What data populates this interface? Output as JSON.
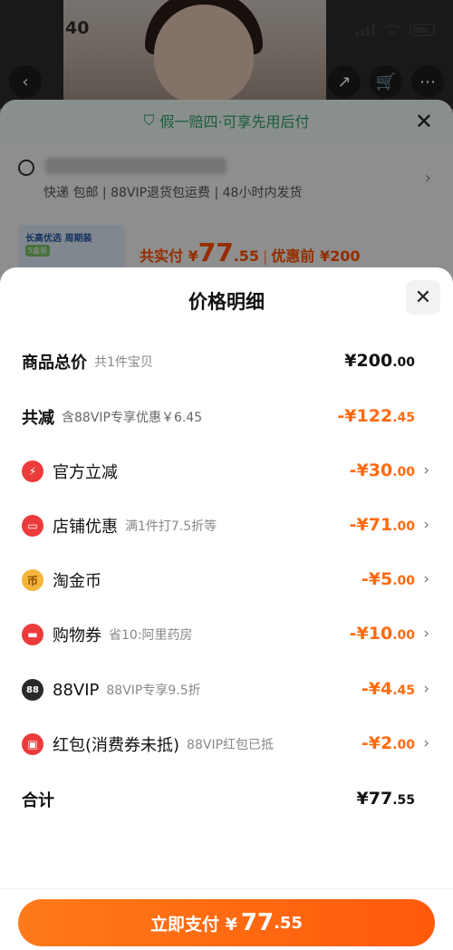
{
  "status": {
    "time": "11:40"
  },
  "background": {
    "banner": "假一赔四·可享先用后付",
    "address_sub": "快递 包邮 | 88VIP退货包运费 | 48小时内发货",
    "thumb_tag": "长高优选 周期装",
    "thumb_badge": "5盒装",
    "summary_label": "共实付 ¥",
    "summary_amount": "77",
    "summary_cents": ".55",
    "summary_before": "优惠前 ¥200"
  },
  "modal": {
    "title": "价格明细",
    "rows": [
      {
        "label": "商品总价",
        "note": "共1件宝贝",
        "amount": "¥200",
        "cents": ".00",
        "icon": "",
        "chevron": false
      },
      {
        "label": "共减",
        "note": "含88VIP专享优惠￥6.45",
        "amount": "-¥122",
        "cents": ".45",
        "icon": "",
        "chevron": false
      },
      {
        "label": "官方立减",
        "note": "",
        "amount": "-¥30",
        "cents": ".00",
        "icon": "lightning-icon",
        "chevron": true
      },
      {
        "label": "店铺优惠",
        "note": "满1件打7.5折等",
        "amount": "-¥71",
        "cents": ".00",
        "icon": "shop-icon",
        "chevron": true
      },
      {
        "label": "淘金币",
        "note": "",
        "amount": "-¥5",
        "cents": ".00",
        "icon": "coin-icon",
        "chevron": true
      },
      {
        "label": "购物券",
        "note": "省10:阿里药房",
        "amount": "-¥10",
        "cents": ".00",
        "icon": "voucher-icon",
        "chevron": true
      },
      {
        "label": "88VIP",
        "note": "88VIP专享9.5折",
        "amount": "-¥4",
        "cents": ".45",
        "icon": "vip88-icon",
        "chevron": true
      },
      {
        "label": "红包(消费券未抵)",
        "note": "88VIP红包已抵",
        "amount": "-¥2",
        "cents": ".00",
        "icon": "red-envelope-icon",
        "chevron": true
      },
      {
        "label": "合计",
        "note": "",
        "amount": "¥77",
        "cents": ".55",
        "icon": "",
        "chevron": false
      }
    ]
  },
  "footer": {
    "pay_label": "立即支付 ¥",
    "pay_amount": "77",
    "pay_cents": ".55"
  },
  "colors": {
    "accent": "#ff6a10",
    "button": "#ff5a0a",
    "guarantee": "#2e9e6a"
  }
}
